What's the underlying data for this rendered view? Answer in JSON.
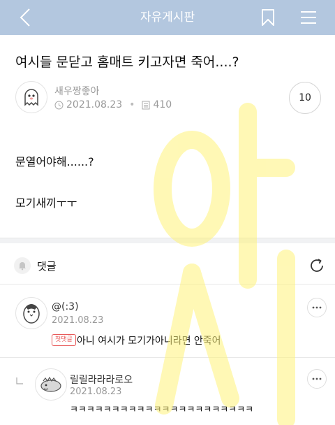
{
  "header": {
    "title": "자유게시판",
    "back_icon": "chevron-left-icon",
    "bookmark_icon": "bookmark-icon",
    "menu_icon": "hamburger-menu-icon",
    "background": "#b3c7df"
  },
  "post": {
    "title": "여시들 문닫고 홈매트 키고자면 죽어....?",
    "author": "새우짱좋아",
    "date": "2021.08.23",
    "views": "410",
    "comment_count": "10",
    "body_lines": [
      "문열어야해......?",
      "모기새끼ㅜㅜ"
    ]
  },
  "comments_section": {
    "label": "댓글",
    "bell_icon": "bell-icon",
    "refresh_icon": "refresh-icon"
  },
  "comments": [
    {
      "author": "@(:3)",
      "date": "2021.08.23",
      "badge": "첫댓글",
      "text": "아니 여시가 모기가아니라면 안죽어"
    },
    {
      "author": "릴릴라라라로오",
      "date": "2021.08.23",
      "text": "ㅋㅋㅋㅋㅋㅋㅋㅋㅋㅋㅋㅋㅋㅋㅋㅋㅋㅋㅋㅋㅋㅋ",
      "is_reply": true
    }
  ],
  "watermark_text": "여시"
}
